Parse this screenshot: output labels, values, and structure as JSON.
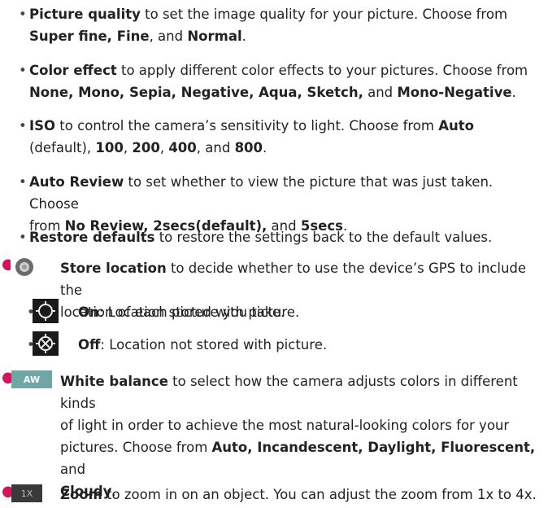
{
  "items": [
    {
      "name": "Picture quality",
      "l1": " to set the image quality for your picture. Choose from",
      "opts": "Super fine, Fine",
      "mid": ", and ",
      "last": "Normal",
      "end": "."
    },
    {
      "name": "Color effect",
      "l1": " to apply different color effects to your pictures. Choose from",
      "opts": "None, Mono, Sepia, Negative, Aqua, Sketch,",
      "mid": " and ",
      "last": "Mono-Negative",
      "end": "."
    },
    {
      "name": "ISO",
      "l1": " to control the camera’s sensitivity to light. Choose from ",
      "first": "Auto",
      "l2a": "(default), ",
      "v100": "100",
      "c1": ", ",
      "v200": "200",
      "c2": ", ",
      "v400": "400",
      "c3": ", and ",
      "v800": "800",
      "end": "."
    },
    {
      "name": "Auto Review",
      "l1": " to set whether to view the picture that was just taken. Choose",
      "l2a": "from ",
      "opts": "No Review, 2secs(default),",
      "mid": " and ",
      "last": "5secs",
      "end": "."
    },
    {
      "name": "Restore defaults",
      "l1": " to restore the settings back to the default values."
    }
  ],
  "store_location": {
    "name": "Store location",
    "l1": " to decide whether to use the device’s GPS to include the",
    "l2": "location of each picture you take.",
    "on_label": "On",
    "on_text": ": Location stored with picture.",
    "off_label": "Off",
    "off_text": ": Location not stored with picture."
  },
  "white_balance": {
    "icon_text": "AW",
    "name": "White balance",
    "l1": " to select how the camera adjusts colors in different kinds",
    "l2": "of light in order to achieve the most natural-looking colors for your",
    "l3": "pictures. Choose from ",
    "opts": "Auto, Incandescent, Daylight, Fluorescent,",
    "mid": " and",
    "last": "Cloudy",
    "end": "."
  },
  "zoom": {
    "icon_text": "1X",
    "name": "Zoom",
    "text": " to zoom in on an object. You can adjust the zoom from 1x to 4x."
  }
}
